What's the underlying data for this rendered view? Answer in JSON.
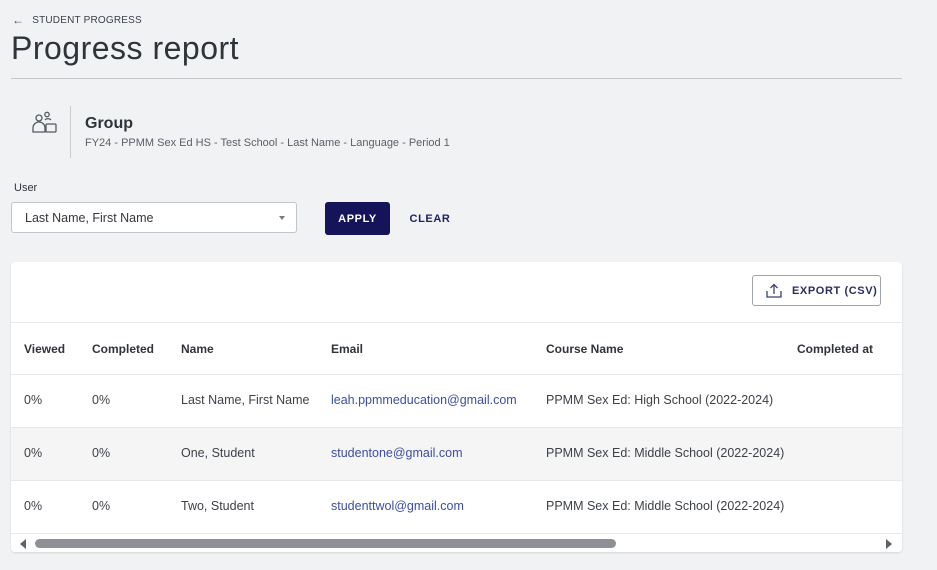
{
  "breadcrumb": {
    "back_icon": "arrow-left-icon",
    "label": "STUDENT PROGRESS"
  },
  "page": {
    "title": "Progress report"
  },
  "group": {
    "icon": "group-users-icon",
    "label": "Group",
    "detail": "FY24 - PPMM Sex Ed HS - Test School - Last Name - Language - Period 1"
  },
  "filter": {
    "user_label": "User",
    "user_value": "Last Name, First Name",
    "apply_label": "APPLY",
    "clear_label": "CLEAR"
  },
  "export": {
    "icon": "upload-icon",
    "label": "EXPORT (CSV)"
  },
  "table": {
    "columns": [
      "Viewed",
      "Completed",
      "Name",
      "Email",
      "Course Name",
      "Completed at"
    ],
    "rows": [
      {
        "viewed": "0%",
        "completed": "0%",
        "name": "Last Name, First Name",
        "email": "leah.ppmmeducation@gmail.com",
        "course": "PPMM Sex Ed: High School (2022-2024)",
        "completed_at": ""
      },
      {
        "viewed": "0%",
        "completed": "0%",
        "name": "One, Student",
        "email": "studentone@gmail.com",
        "course": "PPMM Sex Ed: Middle School (2022-2024)",
        "completed_at": ""
      },
      {
        "viewed": "0%",
        "completed": "0%",
        "name": "Two, Student",
        "email": "studenttwol@gmail.com",
        "course": "PPMM Sex Ed: Middle School (2022-2024)",
        "completed_at": ""
      }
    ]
  },
  "colors": {
    "primary_button": "#15135a",
    "link": "#3e4ea0",
    "background": "#f1f2f4"
  }
}
